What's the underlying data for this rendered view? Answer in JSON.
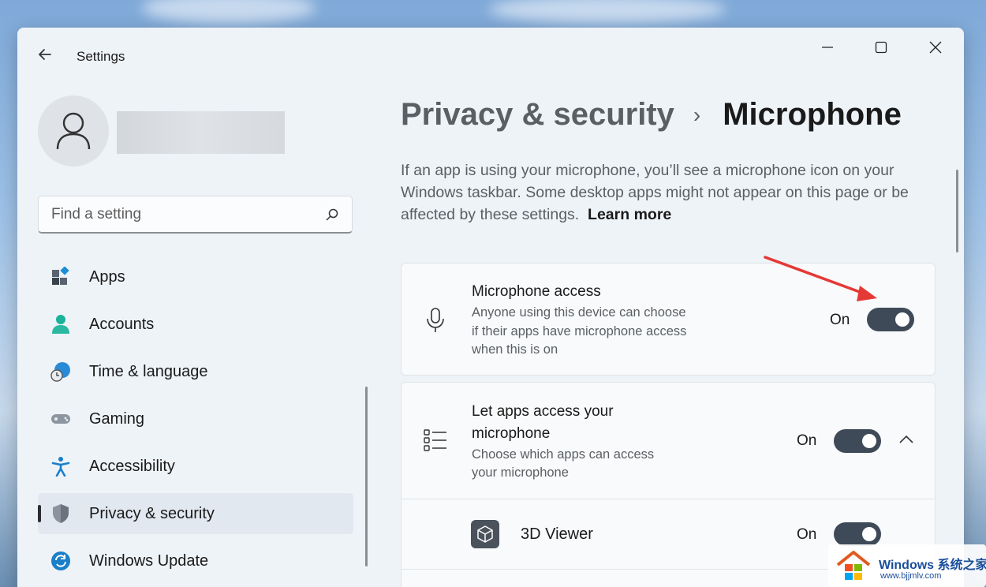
{
  "window": {
    "title": "Settings"
  },
  "sidebar": {
    "search": {
      "placeholder": "Find a setting"
    },
    "items": [
      {
        "label": "Apps",
        "icon": "apps-icon"
      },
      {
        "label": "Accounts",
        "icon": "accounts-icon"
      },
      {
        "label": "Time & language",
        "icon": "time-language-icon"
      },
      {
        "label": "Gaming",
        "icon": "gaming-icon"
      },
      {
        "label": "Accessibility",
        "icon": "accessibility-icon"
      },
      {
        "label": "Privacy & security",
        "icon": "shield-icon",
        "selected": true
      },
      {
        "label": "Windows Update",
        "icon": "windows-update-icon"
      }
    ]
  },
  "main": {
    "breadcrumb": {
      "parent": "Privacy & security",
      "separator": "›",
      "current": "Microphone"
    },
    "description": "If an app is using your microphone, you’ll see a microphone icon on your Windows taskbar. Some desktop apps might not appear on this page or be affected by these settings.",
    "learn_more": "Learn more",
    "mic_access": {
      "title": "Microphone access",
      "subtitle_lines": [
        "Anyone using this device can choose",
        "if their apps have microphone access",
        "when this is on"
      ],
      "state": "On"
    },
    "app_access": {
      "title_lines": [
        "Let apps access your",
        "microphone"
      ],
      "subtitle_lines": [
        "Choose which apps can access",
        "your microphone"
      ],
      "state": "On"
    },
    "apps": [
      {
        "name": "3D Viewer",
        "state": "On"
      }
    ]
  },
  "watermark": {
    "line1": "Windows 系统之家",
    "line2": "www.bjjmlv.com"
  },
  "colors": {
    "toggle_on": "#3e4a57",
    "arrow": "#e53935",
    "selected_bg": "#e1e8f0"
  }
}
